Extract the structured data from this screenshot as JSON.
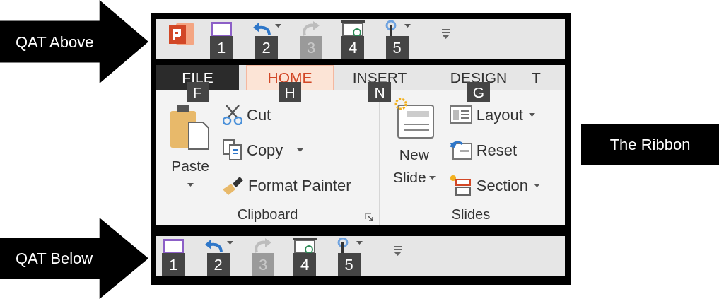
{
  "callouts": {
    "qat_above": "QAT Above",
    "qat_below": "QAT Below",
    "ribbon": "The Ribbon"
  },
  "qat_above": {
    "app_icon": true,
    "items": [
      {
        "kind": "save",
        "keytip": "1",
        "disabled": false,
        "dropdown": false
      },
      {
        "kind": "undo",
        "keytip": "2",
        "disabled": false,
        "dropdown": true
      },
      {
        "kind": "redo",
        "keytip": "3",
        "disabled": true,
        "dropdown": false
      },
      {
        "kind": "start",
        "keytip": "4",
        "disabled": false,
        "dropdown": false
      },
      {
        "kind": "touch",
        "keytip": "5",
        "disabled": false,
        "dropdown": true
      },
      {
        "kind": "customize"
      }
    ]
  },
  "tabs": [
    {
      "label": "FILE",
      "kind": "file",
      "keytip": "F",
      "selected": false
    },
    {
      "label": "HOME",
      "kind": "tab",
      "keytip": "H",
      "selected": true
    },
    {
      "label": "INSERT",
      "kind": "tab",
      "keytip": "N",
      "selected": false
    },
    {
      "label": "DESIGN",
      "kind": "tab",
      "keytip": "G",
      "selected": false
    },
    {
      "label": "T",
      "kind": "tab",
      "selected": false
    }
  ],
  "groups": [
    {
      "name": "Clipboard",
      "launcher": true,
      "large": {
        "kind": "paste",
        "lines": [
          "Paste"
        ],
        "dropdown": true
      },
      "items": [
        {
          "label": "Cut",
          "kind": "cut",
          "dropdown": false
        },
        {
          "label": "Copy",
          "kind": "copy",
          "dropdown": true
        },
        {
          "label": "Format Painter",
          "kind": "format-painter",
          "dropdown": false
        }
      ]
    },
    {
      "name": "Slides",
      "launcher": false,
      "large": {
        "kind": "new-slide",
        "lines": [
          "New",
          "Slide"
        ],
        "dropdown": true
      },
      "items": [
        {
          "label": "Layout",
          "kind": "layout",
          "dropdown": true
        },
        {
          "label": "Reset",
          "kind": "reset",
          "dropdown": false
        },
        {
          "label": "Section",
          "kind": "section",
          "dropdown": true
        }
      ]
    }
  ],
  "qat_below": {
    "app_icon": false,
    "items": [
      {
        "kind": "save",
        "keytip": "1",
        "disabled": false,
        "dropdown": false
      },
      {
        "kind": "undo",
        "keytip": "2",
        "disabled": false,
        "dropdown": true
      },
      {
        "kind": "redo",
        "keytip": "3",
        "disabled": true,
        "dropdown": false
      },
      {
        "kind": "start",
        "keytip": "4",
        "disabled": false,
        "dropdown": false
      },
      {
        "kind": "touch",
        "keytip": "5",
        "disabled": false,
        "dropdown": true
      },
      {
        "kind": "customize"
      }
    ]
  }
}
